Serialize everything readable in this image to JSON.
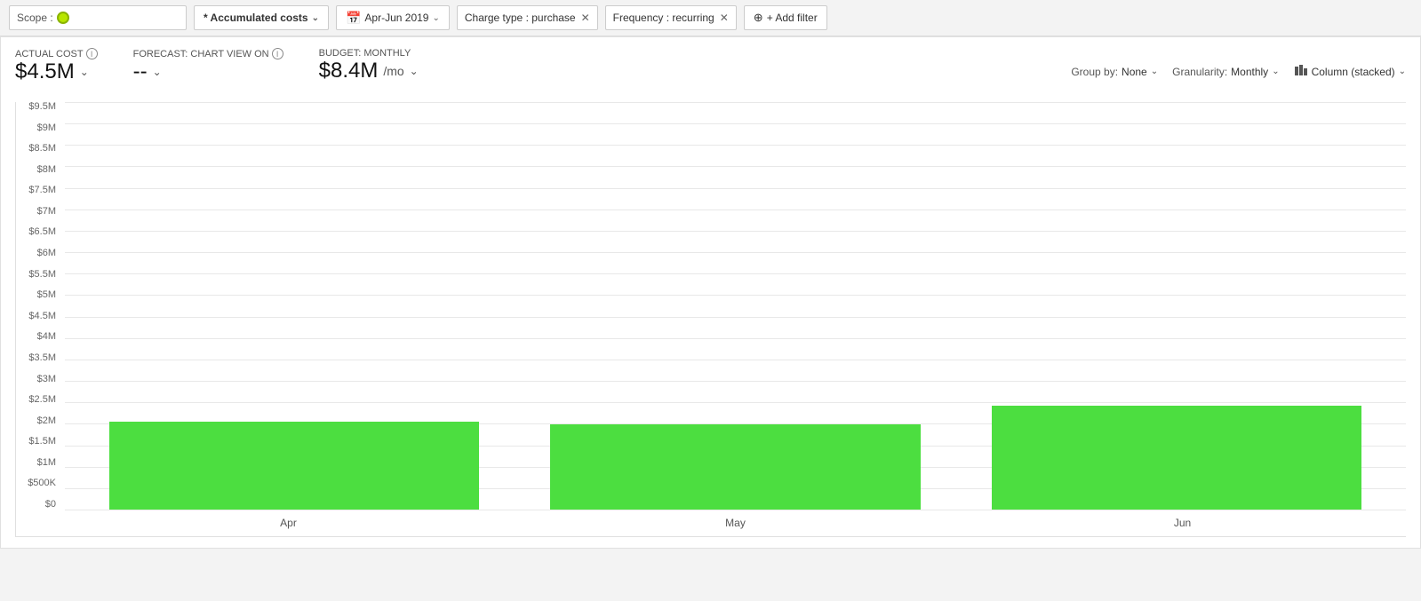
{
  "topbar": {
    "scope_label": "Scope :",
    "accumulated_costs_label": "* Accumulated costs",
    "date_range_label": "Apr-Jun 2019",
    "charge_type_filter": "Charge type : purchase",
    "frequency_filter": "Frequency : recurring",
    "add_filter_label": "+ Add filter"
  },
  "metrics": {
    "actual_cost_label": "ACTUAL COST",
    "actual_cost_value": "$4.5M",
    "forecast_label": "FORECAST: CHART VIEW ON",
    "forecast_value": "--",
    "budget_label": "BUDGET: MONTHLY",
    "budget_value": "$8.4M",
    "budget_suffix": "/mo"
  },
  "chart_controls": {
    "group_by_label": "Group by:",
    "group_by_value": "None",
    "granularity_label": "Granularity:",
    "granularity_value": "Monthly",
    "chart_type_value": "Column (stacked)"
  },
  "y_axis": {
    "labels": [
      "$9.5M",
      "$9M",
      "$8.5M",
      "$8M",
      "$7.5M",
      "$7M",
      "$6.5M",
      "$6M",
      "$5.5M",
      "$5M",
      "$4.5M",
      "$4M",
      "$3.5M",
      "$3M",
      "$2.5M",
      "$2M",
      "$1.5M",
      "$1M",
      "$500K",
      "$0"
    ]
  },
  "x_axis": {
    "labels": [
      "Apr",
      "May",
      "Jun"
    ]
  },
  "bars": [
    {
      "month": "Apr",
      "height_pct": 21.5
    },
    {
      "month": "May",
      "height_pct": 21.0
    },
    {
      "month": "Jun",
      "height_pct": 25.5
    }
  ]
}
